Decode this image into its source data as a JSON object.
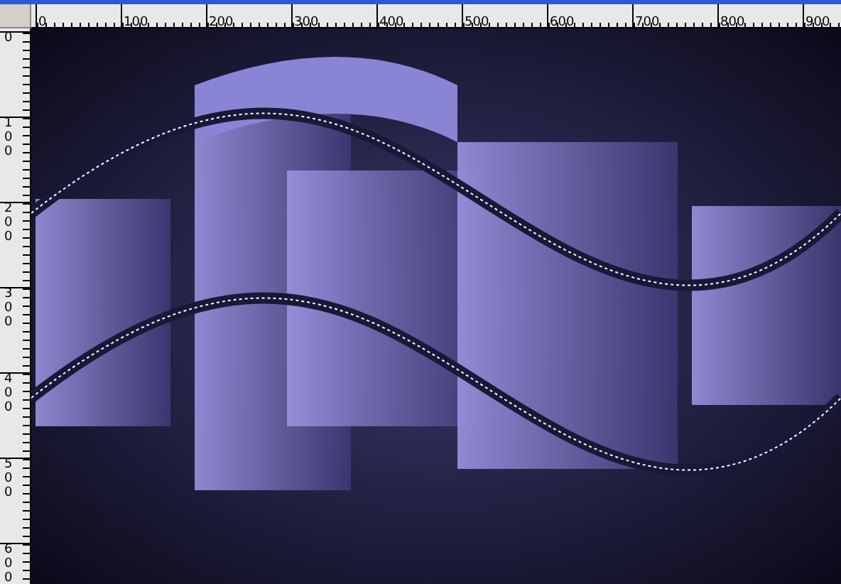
{
  "rulers": {
    "horizontal": [
      "0",
      "100",
      "200",
      "300",
      "400",
      "500",
      "600",
      "700",
      "800",
      "900"
    ],
    "vertical": [
      "0",
      "100",
      "200",
      "300",
      "400",
      "500",
      "600"
    ]
  }
}
